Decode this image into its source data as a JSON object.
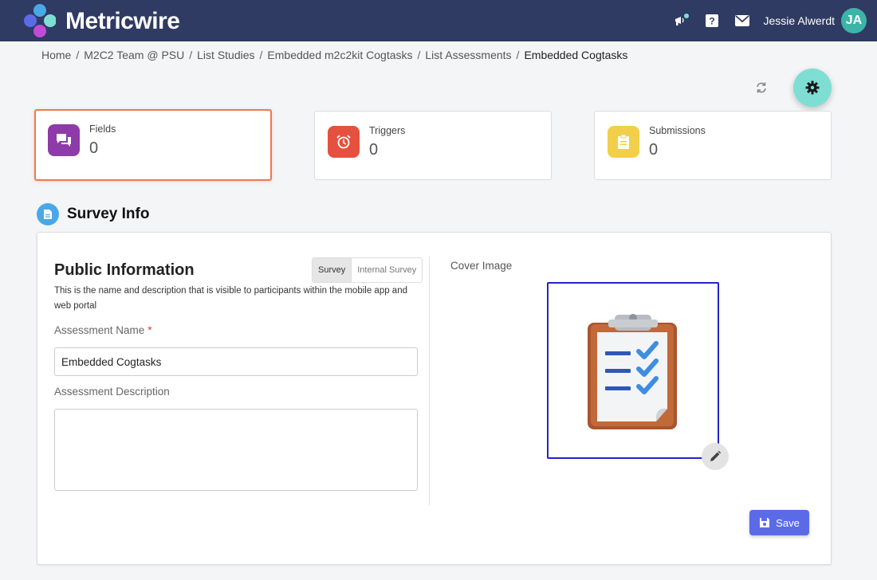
{
  "header": {
    "brand": "Metricwire",
    "user_name": "Jessie Alwerdt",
    "user_initials": "JA",
    "icons": [
      "announcement-icon",
      "help-icon",
      "mail-icon"
    ]
  },
  "breadcrumb": {
    "items": [
      "Home",
      "M2C2 Team @ PSU",
      "List Studies",
      "Embedded m2c2kit Cogtasks",
      "List Assessments"
    ],
    "current": "Embedded Cogtasks",
    "separator": "/"
  },
  "stats": [
    {
      "label": "Fields",
      "value": "0",
      "color": "#8e3aa8",
      "icon": "forum-icon"
    },
    {
      "label": "Triggers",
      "value": "0",
      "color": "#e5513f",
      "icon": "alarm-icon"
    },
    {
      "label": "Submissions",
      "value": "0",
      "color": "#f2cf4a",
      "icon": "clipboard-icon"
    }
  ],
  "survey_info": {
    "title": "Survey Info",
    "public": {
      "title": "Public Information",
      "description": "This is the name and description that is visible to participants within the mobile app and web portal",
      "toggle": [
        "Survey",
        "Internal Survey"
      ],
      "selected_toggle": "Survey"
    },
    "fields": {
      "name_label": "Assessment Name",
      "required_marker": "*",
      "name_value": "Embedded Cogtasks",
      "description_label": "Assessment Description",
      "description_value": ""
    },
    "cover": {
      "label": "Cover Image",
      "image": "clipboard-checklist-image"
    },
    "save_label": "Save"
  },
  "colors": {
    "header_bg": "#2f3b63",
    "active_card_border": "#ea7b4f",
    "fab_bg": "#7fded4",
    "save_bg": "#5b6be8",
    "cover_border": "#2222cc"
  }
}
